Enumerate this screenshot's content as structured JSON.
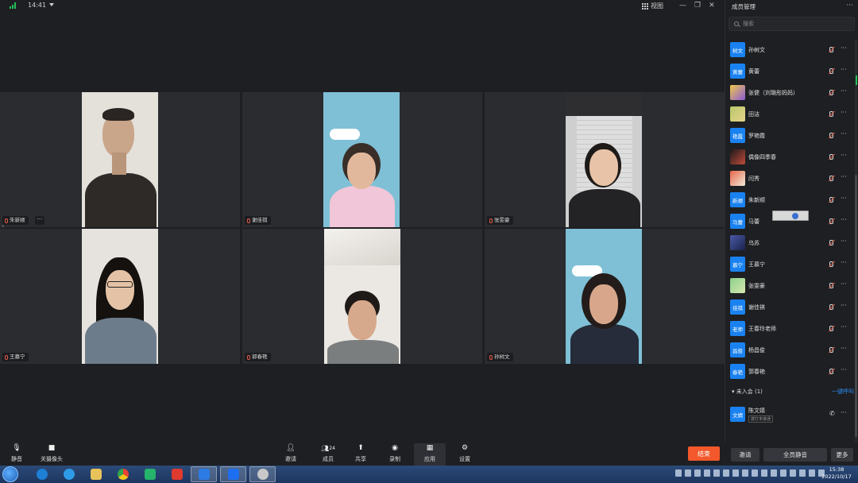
{
  "topbar": {
    "time": "14:41",
    "view_label": "视图",
    "win_min": "—",
    "win_restore": "❐",
    "win_close": "✕"
  },
  "tiles": [
    {
      "name": "朱新顺",
      "bg": "#e8e4df"
    },
    {
      "name": "谢佳祺",
      "bg": "#8ec6d9"
    },
    {
      "name": "张雯豪",
      "bg": "#dcdcdc"
    },
    {
      "name": "王慕宁",
      "bg": "#e6e4e0"
    },
    {
      "name": "郭春艳",
      "bg": "#ece9e5"
    },
    {
      "name": "孙树文",
      "bg": "#8ec6d9"
    }
  ],
  "tile_more": "···",
  "panel": {
    "title": "成员管理",
    "more": "···",
    "search_placeholder": "搜索",
    "members": [
      {
        "avatar_text": "树文",
        "name": "孙树文"
      },
      {
        "avatar_text": "黄蕾",
        "name": "黄蕾"
      },
      {
        "avatar_text": "",
        "name": "张健（刘璐彤妈妈）"
      },
      {
        "avatar_text": "",
        "name": "田洁"
      },
      {
        "avatar_text": "艳霞",
        "name": "罗艳霞"
      },
      {
        "avatar_text": "",
        "name": "偶像四季春"
      },
      {
        "avatar_text": "",
        "name": "闫秀"
      },
      {
        "avatar_text": "新顺",
        "name": "朱新顺"
      },
      {
        "avatar_text": "马蕾",
        "name": "马蕾"
      },
      {
        "avatar_text": "",
        "name": "乌苏"
      },
      {
        "avatar_text": "慕宁",
        "name": "王慕宁"
      },
      {
        "avatar_text": "",
        "name": "张雯豪"
      },
      {
        "avatar_text": "佳祺",
        "name": "谢佳祺"
      },
      {
        "avatar_text": "老师",
        "name": "王春玲老师"
      },
      {
        "avatar_text": "昌俊",
        "name": "杨昌俊"
      },
      {
        "avatar_text": "春艳",
        "name": "郭春艳"
      }
    ],
    "not_joined_label": "未入会 (1)",
    "call_all": "一键呼叫",
    "pending": {
      "avatar_text": "文婧",
      "name": "陈文婧",
      "note": "拨打未接通"
    }
  },
  "toolbar": {
    "mute": "静音",
    "camera": "关摄像头",
    "invite": "邀请",
    "members": "成员",
    "members_count": "24",
    "share": "共享",
    "record": "录制",
    "apps": "应用",
    "settings": "设置",
    "end": "结束",
    "invite_right": "邀请",
    "mute_all": "全员静音",
    "more": "更多"
  },
  "taskbar": {
    "time": "15:38",
    "date": "2022/10/17"
  },
  "colors": {
    "accent": "#1a82f0",
    "end_button": "#f2582b",
    "background": "#1e1f22"
  }
}
